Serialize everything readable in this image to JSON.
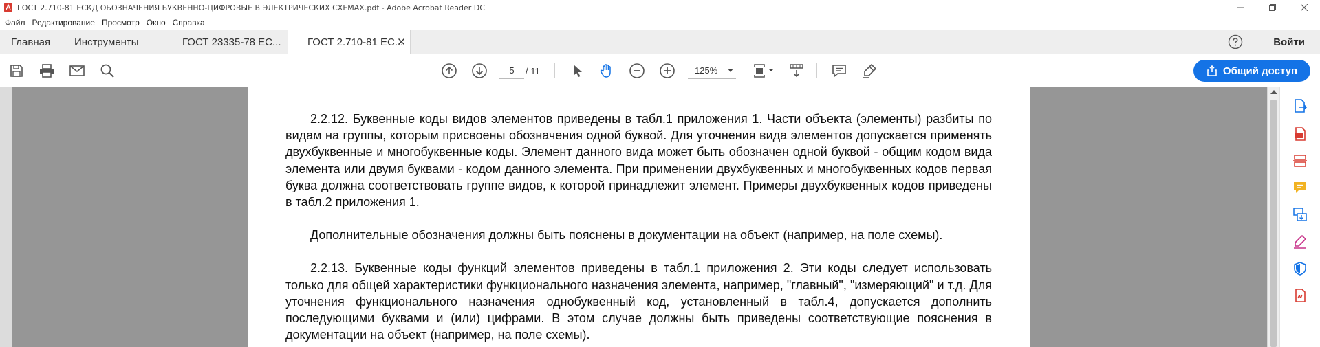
{
  "window": {
    "title": "ГОСТ 2.710-81 ЕСКД ОБОЗНАЧЕНИЯ БУКВЕННО-ЦИФРОВЫЕ В ЭЛЕКТРИЧЕСКИХ СХЕМАХ.pdf - Adobe Acrobat Reader DC"
  },
  "menu": [
    "Файл",
    "Редактирование",
    "Просмотр",
    "Окно",
    "Справка"
  ],
  "tabs": {
    "home": "Главная",
    "tools": "Инструменты",
    "doc1": "ГОСТ 23335-78 ЕС...",
    "doc2": "ГОСТ 2.710-81 ЕС..."
  },
  "header": {
    "login": "Войти"
  },
  "toolbar": {
    "page_current": "5",
    "page_total": "/ 11",
    "zoom": "125%",
    "share_label": "Общий доступ"
  },
  "document": {
    "paragraphs": [
      "2.2.12. Буквенные коды видов элементов приведены в табл.1 приложения 1. Части объекта (элементы) разбиты по видам на группы, которым присвоены обозначения одной буквой. Для уточнения вида элементов допускается применять двухбуквенные и многобуквенные коды. Элемент данного вида может быть обозначен одной буквой - общим кодом вида элемента или двумя буквами - кодом данного элемента. При применении двухбуквенных и многобуквенных кодов первая буква должна соответствовать группе видов, к которой принадлежит элемент. Примеры двухбуквенных кодов приведены в табл.2 приложения 1.",
      "Дополнительные обозначения должны быть пояснены в документации на объект (например, на поле схемы).",
      "2.2.13. Буквенные коды функций элементов приведены в табл.1 приложения 2. Эти коды следует использовать только для общей характеристики функционального назначения элемента, например, \"главный\", \"измеряющий\" и т.д. Для уточнения функционального назначения однобуквенный код, установленный в табл.4, допускается дополнить последующими буквами и (или) цифрами. В этом случае должны быть приведены соответствующие пояснения в документации на объект (например, на поле схемы)."
    ]
  },
  "colors": {
    "accent": "#1473e6",
    "viewport_bg": "#969696",
    "acrobat_red": "#d83b31"
  }
}
